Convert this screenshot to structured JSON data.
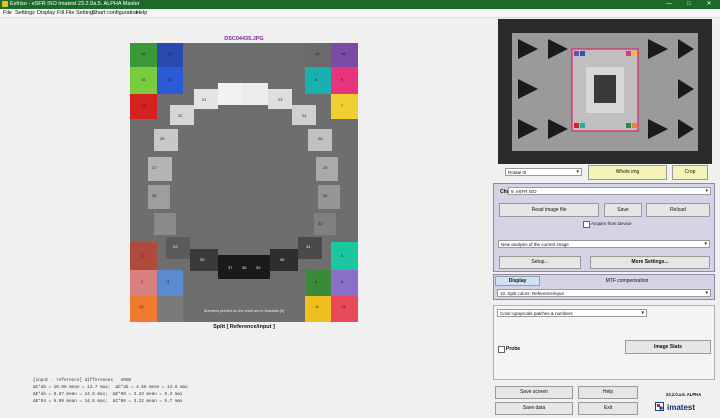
{
  "window": {
    "title": "Esfriso - eSFR ISO  Imatest 23.2.0a.5. ALPHA  Master",
    "controls": {
      "minimize": "—",
      "maximize": "□",
      "close": "✕"
    }
  },
  "menu": [
    "File",
    "Settings",
    "Display",
    "Fill File Settings",
    "Chart configuration",
    "Help"
  ],
  "chart": {
    "filename": "DSC04435.JPG",
    "note": "Numbers printed on the chart are in brackets [n]",
    "caption": "Split  [ Reference/input ]"
  },
  "patch_colors": {
    "purple": "#7b4aa5",
    "pink": "#e8347a",
    "blue_dark": "#2a52b8",
    "lime": "#6fb83a",
    "red": "#d82020",
    "gold": "#f0c020",
    "teal": "#1ab0b0",
    "orange": "#f08030",
    "salmon": "#d88080",
    "sky": "#5a9ad0",
    "green": "#2a8a4a",
    "crimson": "#c03030",
    "lavender": "#8a70c8",
    "amber": "#f0a030",
    "olive": "#4a6a3a"
  },
  "stats": {
    "header": "[input - reference] differences   sRGB",
    "lines": [
      "ΔC*ab = 10.65 mean = 14.7 max;  ΔC*ab = 4.55 mean = 14.6 max",
      "ΔE*ab = 8.67 mean = 14.5 max;  ΔE*00 = 3.23 mean = 9.3 max",
      "ΔE*94 = 5.99 mean = 14.5 max;  ΔC*00 = 3.22 mean = 5.7 max"
    ]
  },
  "controls": {
    "rotate_select": "Rotate 0l",
    "whole_img": "Whole img",
    "crop": "Crop",
    "chart_label": "Chart",
    "chart_select": "9. eSFR ISO",
    "read_image": "Read image file",
    "save": "Save",
    "reload": "Reload",
    "acquire_checkbox": "Acquire from Device",
    "analysis_select": "New analysis of the current image",
    "setup": "Setup...",
    "more_settings": "More Settings...",
    "tab_display": "Display",
    "tab_mtf": "MTF compensation",
    "display_select": "10. Split colors: Reference/input",
    "color_select": "Color+grayscale patches & numbers",
    "probe": "Probe",
    "image_stats": "Image Stats",
    "save_screen": "Save screen",
    "help": "Help",
    "save_data": "Save data",
    "exit": "Exit",
    "version": "23.2.0.a.5. ALPHA",
    "brand": "imatest"
  },
  "patch_labels": {
    "c16": "16",
    "c17": "17",
    "c18": "18",
    "c19": "19",
    "c15": "15",
    "c20": "20",
    "c12": "12",
    "c1": "1",
    "c2": "2",
    "c3": "3",
    "c4": "4",
    "c5": "5",
    "c6": "6",
    "c7": "7",
    "c8": "8",
    "c9": "9",
    "c10": "10",
    "c11": "11",
    "c13": "13",
    "c14": "14",
    "g21": "21",
    "g22": "22",
    "g23": "23",
    "g24": "24",
    "g25": "25",
    "g26": "26",
    "g27": "27",
    "g28": "28",
    "g29": "29",
    "g30": "30",
    "g31": "31",
    "g32": "32",
    "g33": "33",
    "g34": "34",
    "g35": "35",
    "g36": "36",
    "g37": "37",
    "g38": "38",
    "g39": "39",
    "g40": "40"
  }
}
